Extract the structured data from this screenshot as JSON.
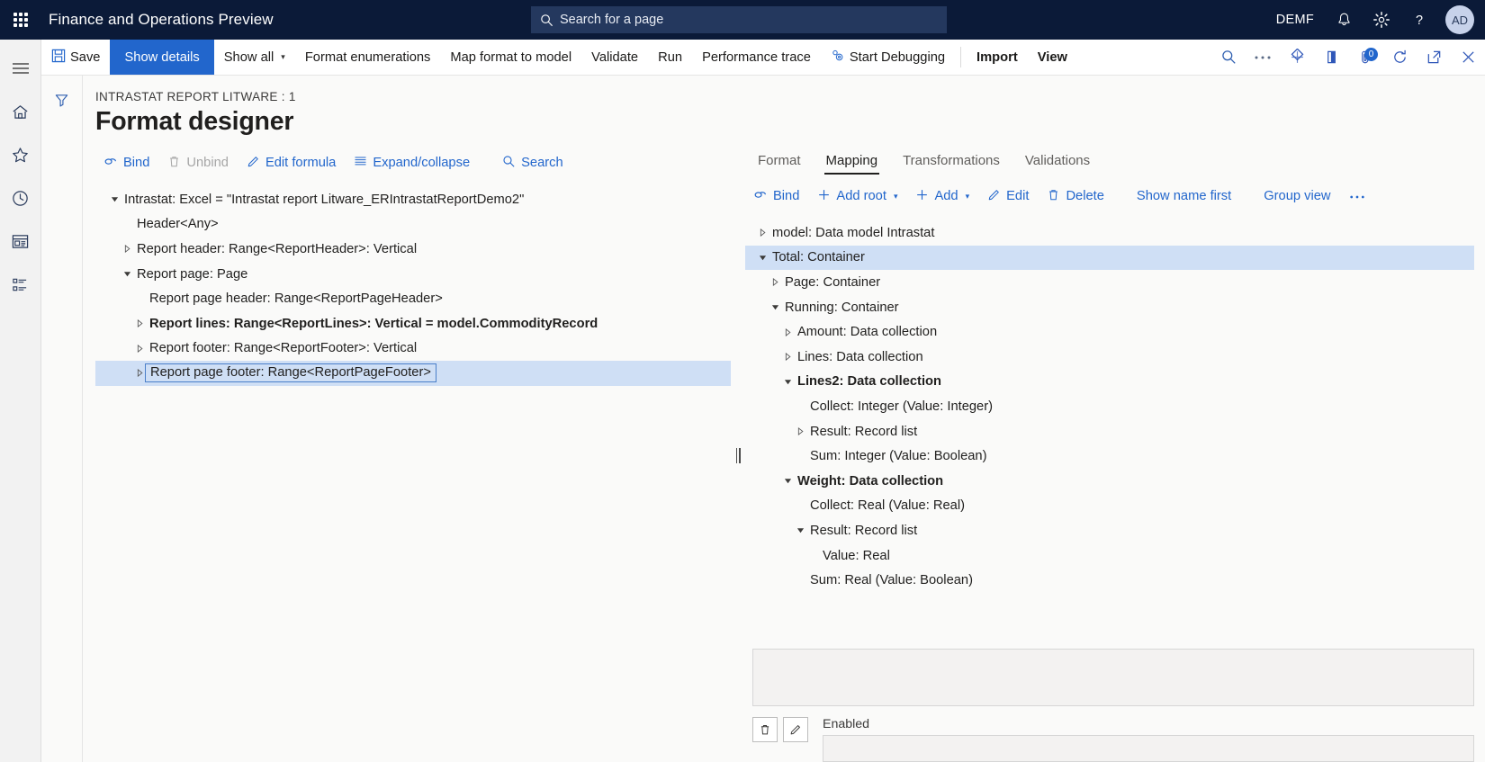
{
  "topnav": {
    "waffle_icon": "app-launcher-icon",
    "app_title": "Finance and Operations Preview",
    "search": {
      "icon": "search-icon",
      "placeholder": "Search for a page",
      "value": "Search for a page"
    },
    "company_id": "DEMF",
    "notifications_icon": "bell-icon",
    "settings_icon": "gear-icon",
    "help_icon": "help-question-icon",
    "avatar_initials": "AD"
  },
  "rail": {
    "items": [
      {
        "icon": "hamburger-menu-icon",
        "name": "nav-menu"
      },
      {
        "icon": "home-icon",
        "name": "home"
      },
      {
        "icon": "star-icon",
        "name": "favorites"
      },
      {
        "icon": "clock-icon",
        "name": "recent"
      },
      {
        "icon": "workspace-icon",
        "name": "workspaces"
      },
      {
        "icon": "modules-list-icon",
        "name": "modules"
      }
    ]
  },
  "commandbar": {
    "items": [
      {
        "label": "Save",
        "icon": "save-floppy-icon",
        "state": "normal"
      },
      {
        "label": "Show details",
        "icon": "",
        "state": "active"
      },
      {
        "label": "Show all",
        "icon": "",
        "state": "dropdown"
      },
      {
        "label": "Format enumerations",
        "icon": "",
        "state": "normal"
      },
      {
        "label": "Map format to model",
        "icon": "",
        "state": "normal"
      },
      {
        "label": "Validate",
        "icon": "",
        "state": "normal"
      },
      {
        "label": "Run",
        "icon": "",
        "state": "normal"
      },
      {
        "label": "Performance trace",
        "icon": "",
        "state": "normal"
      },
      {
        "label": "Start Debugging",
        "icon": "debug-gears-icon",
        "state": "normal"
      },
      {
        "label": "Import",
        "icon": "",
        "state": "bold"
      },
      {
        "label": "View",
        "icon": "",
        "state": "bold"
      }
    ],
    "right_icons": [
      {
        "name": "search-icon",
        "badge": ""
      },
      {
        "name": "overflow-ellipsis-icon",
        "badge": ""
      },
      {
        "name": "share-diamond-icon",
        "badge": ""
      },
      {
        "name": "office-app-icon",
        "badge": ""
      },
      {
        "name": "attachments-icon",
        "badge": "0"
      },
      {
        "name": "refresh-icon",
        "badge": ""
      },
      {
        "name": "open-in-new-window-icon",
        "badge": ""
      },
      {
        "name": "close-icon",
        "badge": ""
      }
    ]
  },
  "page": {
    "filter_icon": "filter-funnel-icon",
    "breadcrumb": "INTRASTAT REPORT LITWARE : 1",
    "title": "Format designer"
  },
  "left_pane": {
    "actions": [
      {
        "label": "Bind",
        "icon": "link-bind-icon",
        "disabled": false,
        "dropdown": false
      },
      {
        "label": "Unbind",
        "icon": "trash-icon",
        "disabled": true,
        "dropdown": false
      },
      {
        "label": "Edit formula",
        "icon": "pencil-icon",
        "disabled": false,
        "dropdown": false
      },
      {
        "label": "Expand/collapse",
        "icon": "list-lines-icon",
        "disabled": false,
        "dropdown": false
      },
      {
        "label": "Search",
        "icon": "search-icon",
        "disabled": false,
        "dropdown": false
      }
    ],
    "tree": [
      {
        "label": "Intrastat: Excel = \"Intrastat report Litware_ERIntrastatReportDemo2\"",
        "indent": 0,
        "twist": "expanded",
        "bold": false,
        "selected": false
      },
      {
        "label": "Header<Any>",
        "indent": 1,
        "twist": "none",
        "bold": false,
        "selected": false
      },
      {
        "label": "Report header: Range<ReportHeader>: Vertical",
        "indent": 1,
        "twist": "collapsed",
        "bold": false,
        "selected": false
      },
      {
        "label": "Report page: Page",
        "indent": 1,
        "twist": "expanded",
        "bold": false,
        "selected": false
      },
      {
        "label": "Report page header: Range<ReportPageHeader>",
        "indent": 2,
        "twist": "none",
        "bold": false,
        "selected": false
      },
      {
        "label": "Report lines: Range<ReportLines>: Vertical = model.CommodityRecord",
        "indent": 2,
        "twist": "collapsed",
        "bold": true,
        "selected": false
      },
      {
        "label": "Report footer: Range<ReportFooter>: Vertical",
        "indent": 2,
        "twist": "collapsed",
        "bold": false,
        "selected": false
      },
      {
        "label": "Report page footer: Range<ReportPageFooter>",
        "indent": 2,
        "twist": "collapsed",
        "bold": false,
        "selected": true
      }
    ]
  },
  "right_pane": {
    "tabs": [
      {
        "label": "Format",
        "active": false
      },
      {
        "label": "Mapping",
        "active": true
      },
      {
        "label": "Transformations",
        "active": false
      },
      {
        "label": "Validations",
        "active": false
      }
    ],
    "actions": [
      {
        "label": "Bind",
        "icon": "link-bind-icon",
        "disabled": false,
        "dropdown": false
      },
      {
        "label": "Add root",
        "icon": "plus-icon",
        "disabled": false,
        "dropdown": true
      },
      {
        "label": "Add",
        "icon": "plus-icon",
        "disabled": false,
        "dropdown": true
      },
      {
        "label": "Edit",
        "icon": "pencil-icon",
        "disabled": false,
        "dropdown": false
      },
      {
        "label": "Delete",
        "icon": "trash-icon",
        "disabled": false,
        "dropdown": false
      },
      {
        "label": "Show name first",
        "icon": "",
        "disabled": false,
        "dropdown": false
      },
      {
        "label": "Group view",
        "icon": "",
        "disabled": false,
        "dropdown": false
      },
      {
        "label": "...",
        "icon": "overflow-ellipsis-icon",
        "disabled": false,
        "dropdown": false
      }
    ],
    "tree": [
      {
        "label": "model: Data model Intrastat",
        "indent": 0,
        "twist": "collapsed",
        "bold": false,
        "selected": false
      },
      {
        "label": "Total: Container",
        "indent": 0,
        "twist": "expanded",
        "bold": false,
        "selected": true
      },
      {
        "label": "Page: Container",
        "indent": 1,
        "twist": "collapsed",
        "bold": false,
        "selected": false
      },
      {
        "label": "Running: Container",
        "indent": 1,
        "twist": "expanded",
        "bold": false,
        "selected": false
      },
      {
        "label": "Amount: Data collection",
        "indent": 2,
        "twist": "collapsed",
        "bold": false,
        "selected": false
      },
      {
        "label": "Lines: Data collection",
        "indent": 2,
        "twist": "collapsed",
        "bold": false,
        "selected": false
      },
      {
        "label": "Lines2: Data collection",
        "indent": 2,
        "twist": "expanded",
        "bold": true,
        "selected": false
      },
      {
        "label": "Collect: Integer (Value: Integer)",
        "indent": 3,
        "twist": "none",
        "bold": false,
        "selected": false
      },
      {
        "label": "Result: Record list",
        "indent": 3,
        "twist": "collapsed",
        "bold": false,
        "selected": false
      },
      {
        "label": "Sum: Integer (Value: Boolean)",
        "indent": 3,
        "twist": "none",
        "bold": false,
        "selected": false
      },
      {
        "label": "Weight: Data collection",
        "indent": 2,
        "twist": "expanded",
        "bold": true,
        "selected": false
      },
      {
        "label": "Collect: Real (Value: Real)",
        "indent": 3,
        "twist": "none",
        "bold": false,
        "selected": false
      },
      {
        "label": "Result: Record list",
        "indent": 3,
        "twist": "expanded",
        "bold": false,
        "selected": false
      },
      {
        "label": "Value: Real",
        "indent": 4,
        "twist": "none",
        "bold": false,
        "selected": false
      },
      {
        "label": "Sum: Real (Value: Boolean)",
        "indent": 3,
        "twist": "none",
        "bold": false,
        "selected": false
      }
    ],
    "formula_value": "",
    "delete_button_icon": "trash-icon",
    "edit_button_icon": "pencil-icon",
    "enabled_label": "Enabled",
    "enabled_value": ""
  },
  "colors": {
    "nav_background": "#0b1a38",
    "accent_blue": "#2266cc",
    "link_blue": "#2266cc",
    "selection_blue": "#cfdff5",
    "page_background": "#fafaf9",
    "disabled_gray": "#a6a6a6"
  }
}
